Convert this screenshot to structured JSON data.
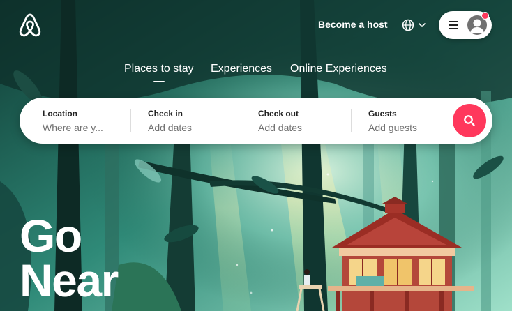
{
  "header": {
    "logo_icon": "airbnb-belo-logo-icon",
    "become_host_label": "Become a host",
    "language_icon": "globe-icon",
    "menu_icon": "hamburger-menu-icon",
    "avatar_icon": "user-avatar-icon",
    "notification_color": "#ff385c"
  },
  "tabs": [
    {
      "label": "Places to stay",
      "active": true
    },
    {
      "label": "Experiences",
      "active": false
    },
    {
      "label": "Online Experiences",
      "active": false
    }
  ],
  "search": {
    "location": {
      "label": "Location",
      "placeholder": "Where are y..."
    },
    "check_in": {
      "label": "Check in",
      "placeholder": "Add dates"
    },
    "check_out": {
      "label": "Check out",
      "placeholder": "Add dates"
    },
    "guests": {
      "label": "Guests",
      "placeholder": "Add guests"
    },
    "search_icon": "search-icon",
    "accent_color": "#ff385c"
  },
  "hero": {
    "headline_line1": "Go",
    "headline_line2": "Near"
  }
}
